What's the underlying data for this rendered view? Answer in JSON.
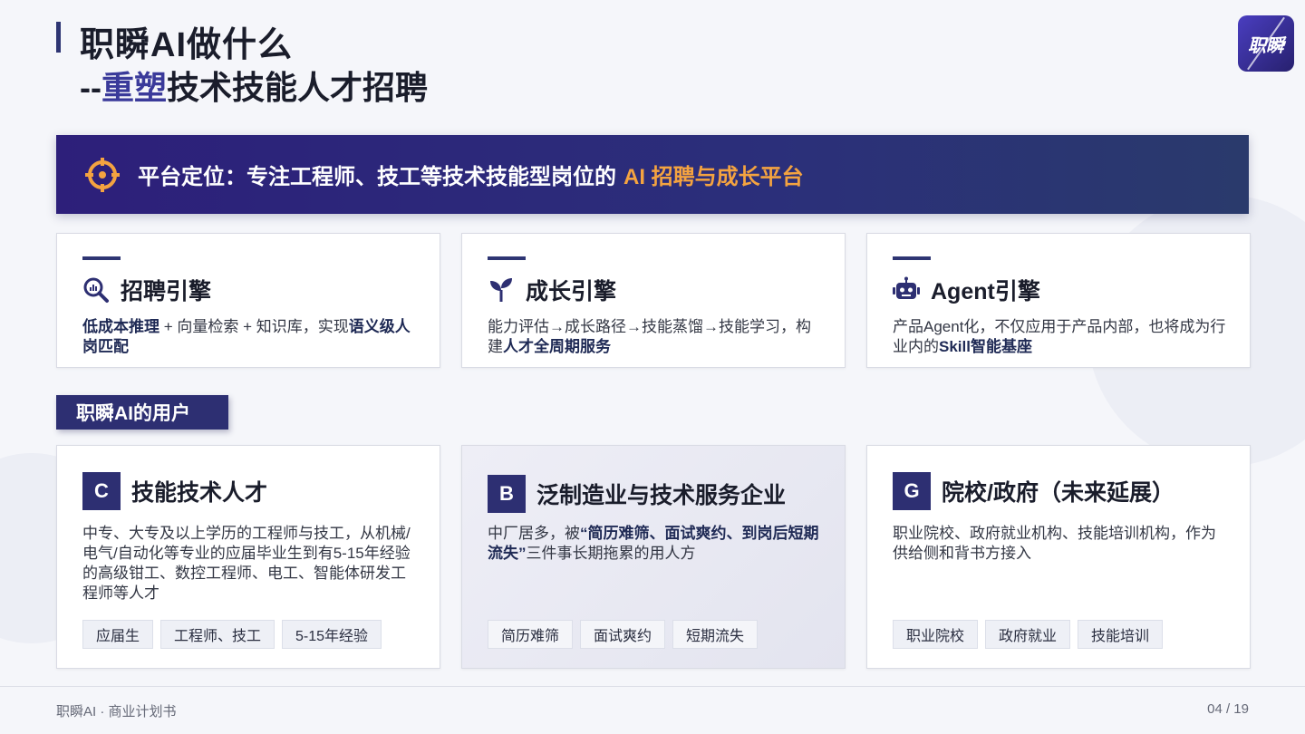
{
  "header": {
    "title_line1": "职瞬AI做什么",
    "title_line2_prefix": "--",
    "title_line2_accent": "重塑",
    "title_line2_rest": "技术技能人才招聘",
    "logo_text": "职瞬"
  },
  "banner": {
    "text": "平台定位：专注工程师、技工等技术技能型岗位的",
    "highlight": "AI 招聘与成长平台",
    "icon": "target-icon"
  },
  "engines": [
    {
      "title": "招聘引擎",
      "icon": "search-analytics-icon",
      "desc_b1": "低成本推理",
      "desc_t1": " + 向量检索 + 知识库，实现",
      "desc_b2": "语义级人岗匹配"
    },
    {
      "title": "成长引擎",
      "icon": "sprout-icon",
      "desc_t1": "能力评估→成长路径→技能蒸馏→技能学习，构建",
      "desc_b1": "人才全周期服务"
    },
    {
      "title": "Agent引擎",
      "icon": "robot-icon",
      "desc_t1": "产品Agent化，不仅应用于产品内部，也将成为行业内的",
      "desc_b1": "Skill智能基座"
    }
  ],
  "users_tag": "职瞬AI的用户",
  "users": [
    {
      "badge": "C",
      "title": "技能技术人才",
      "desc": "中专、大专及以上学历的工程师与技工，从机械/电气/自动化等专业的应届毕业生到有5-15年经验的高级钳工、数控工程师、电工、智能体研发工程师等人才",
      "chips": [
        "应届生",
        "工程师、技工",
        "5-15年经验"
      ]
    },
    {
      "badge": "B",
      "title": "泛制造业与技术服务企业",
      "desc_t1": "中厂居多，被",
      "desc_b1": "“简历难筛、面试爽约、到岗后短期流失”",
      "desc_t2": "三件事长期拖累的用人方",
      "chips": [
        "简历难筛",
        "面试爽约",
        "短期流失"
      ]
    },
    {
      "badge": "G",
      "title": "院校/政府（未来延展）",
      "desc": "职业院校、政府就业机构、技能培训机构，作为供给侧和背书方接入",
      "chips": [
        "职业院校",
        "政府就业",
        "技能培训"
      ]
    }
  ],
  "footer": {
    "left": "职瞬AI · 商业计划书",
    "right": "04 / 19"
  },
  "colors": {
    "primary": "#2d2f72",
    "accent_orange": "#f4a340",
    "background": "#f5f6fa"
  }
}
